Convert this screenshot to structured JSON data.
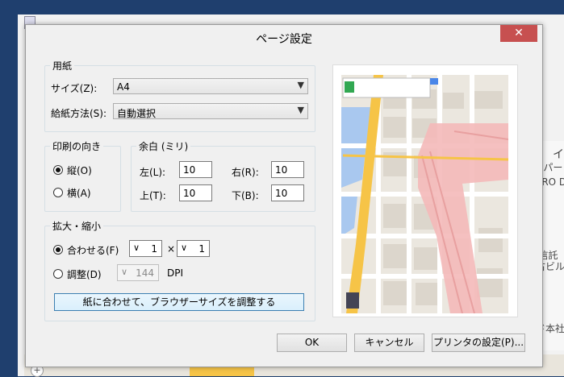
{
  "background": {
    "side_texts": [
      "イ",
      "&パー",
      "TRO D",
      "J信託",
      "古ビル",
      "ド本社"
    ],
    "plus_label": "+"
  },
  "dialog": {
    "title": "ページ設定",
    "close_label": "✕"
  },
  "paper": {
    "legend": "用紙",
    "size_label": "サイズ(Z):",
    "size_value": "A4",
    "source_label": "給紙方法(S):",
    "source_value": "自動選択"
  },
  "orientation": {
    "legend": "印刷の向き",
    "portrait_label": "縦(O)",
    "landscape_label": "横(A)",
    "selected": "portrait"
  },
  "margins": {
    "legend": "余白 (ミリ)",
    "left_label": "左(L):",
    "left_value": "10",
    "right_label": "右(R):",
    "right_value": "10",
    "top_label": "上(T):",
    "top_value": "10",
    "bottom_label": "下(B):",
    "bottom_value": "10"
  },
  "scaling": {
    "legend": "拡大・縮小",
    "fit_label": "合わせる(F)",
    "fit_wide": "1",
    "times": "×",
    "fit_tall": "1",
    "adjust_label": "調整(D)",
    "dpi_value": "144",
    "dpi_unit": "DPI",
    "fit_browser_label": "紙に合わせて、ブラウザーサイズを調整する"
  },
  "buttons": {
    "ok": "OK",
    "cancel": "キャンセル",
    "printer": "プリンタの設定(P)..."
  },
  "colors": {
    "close_red": "#c75050",
    "map_yellow": "#f6c447",
    "map_pink": "#f4b9b9",
    "map_water": "#a9c8ef"
  }
}
